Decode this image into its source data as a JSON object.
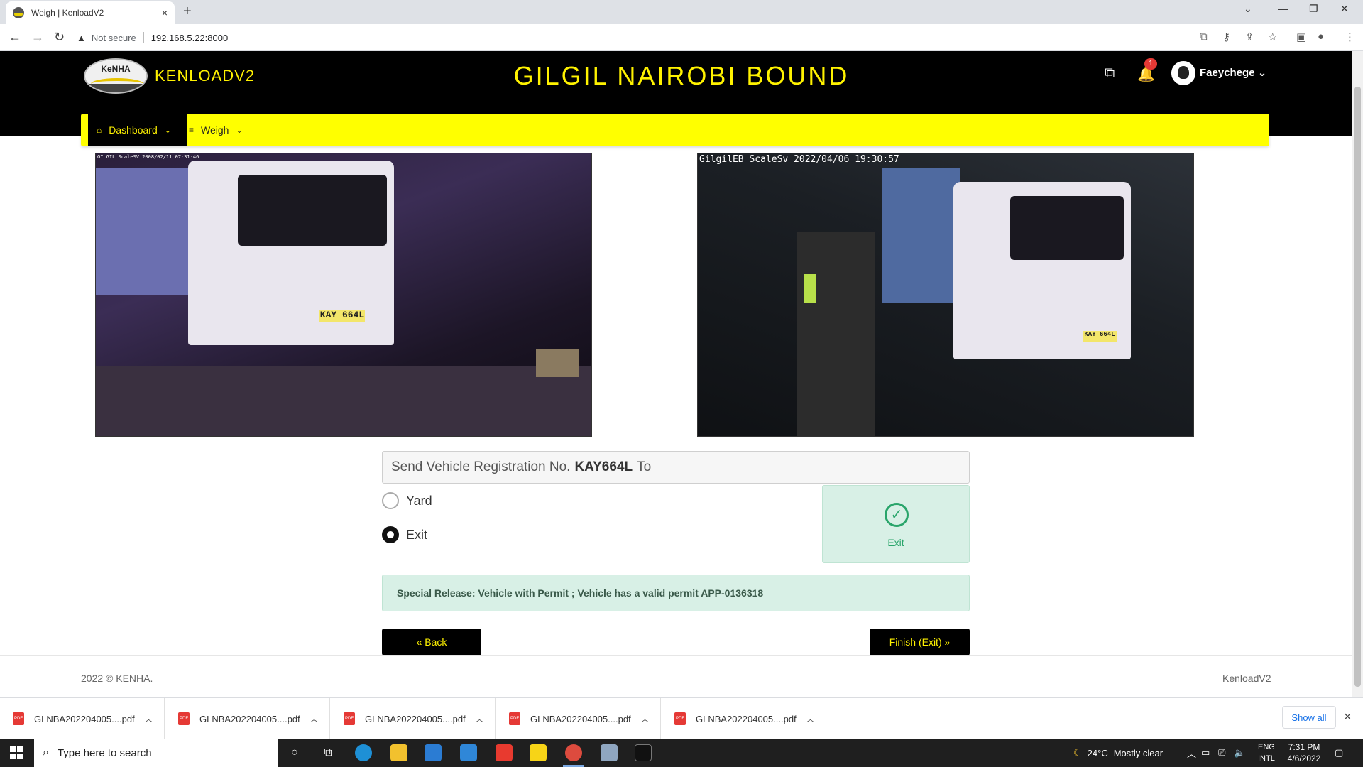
{
  "browser": {
    "tab_title": "Weigh | KenloadV2",
    "tab_close": "×",
    "new_tab": "+",
    "security_label": "Not secure",
    "url": "192.168.5.22:8000"
  },
  "header": {
    "logo_text": "KeNHA",
    "app_name": "KENLOADV2",
    "station_title": "GILGIL NAIROBI BOUND",
    "notification_count": "1",
    "username": "Faeychege",
    "username_chevron": "⌄"
  },
  "menu": {
    "items": [
      {
        "label": "Dashboard",
        "icon": "home-icon"
      },
      {
        "label": "Weigh",
        "icon": "list-icon"
      }
    ]
  },
  "cameras": {
    "left_stamp": "GILGIL ScaleSV 2008/02/11 07:31:46",
    "left_plate": "KAY 664L",
    "right_stamp": "GilgilEB ScaleSv 2022/04/06 19:30:57",
    "right_plate": "KAY 664L"
  },
  "send": {
    "prefix": "Send Vehicle Registration No.",
    "plate": "KAY664L",
    "suffix": "To"
  },
  "options": [
    {
      "label": "Yard",
      "checked": false
    },
    {
      "label": "Exit",
      "checked": true
    }
  ],
  "selected_card": {
    "label": "Exit",
    "check": "✓",
    "accent": "#2aa56b"
  },
  "alert": {
    "text": "Special Release: Vehicle with Permit ; Vehicle has a valid permit APP-0136318"
  },
  "buttons": {
    "back": "«  Back",
    "finish": "Finish (Exit)    »"
  },
  "footer": {
    "copyright": "2022 © KENHA.",
    "version": "KenloadV2"
  },
  "downloads": {
    "items": [
      "GLNBA202204005....pdf",
      "GLNBA202204005....pdf",
      "GLNBA202204005....pdf",
      "GLNBA202204005....pdf",
      "GLNBA202204005....pdf"
    ],
    "pdf_badge": "PDF",
    "show_all": "Show all",
    "close": "×"
  },
  "taskbar": {
    "search_placeholder": "Type here to search",
    "weather_temp": "24°C",
    "weather_desc": "Mostly clear",
    "lang_1": "ENG",
    "lang_2": "INTL",
    "time": "7:31 PM",
    "date": "4/6/2022"
  },
  "colors": {
    "brand_yellow": "#ffff00",
    "title_yellow": "#fff200",
    "header_black": "#000000",
    "success_bg": "#d8f0e6"
  }
}
